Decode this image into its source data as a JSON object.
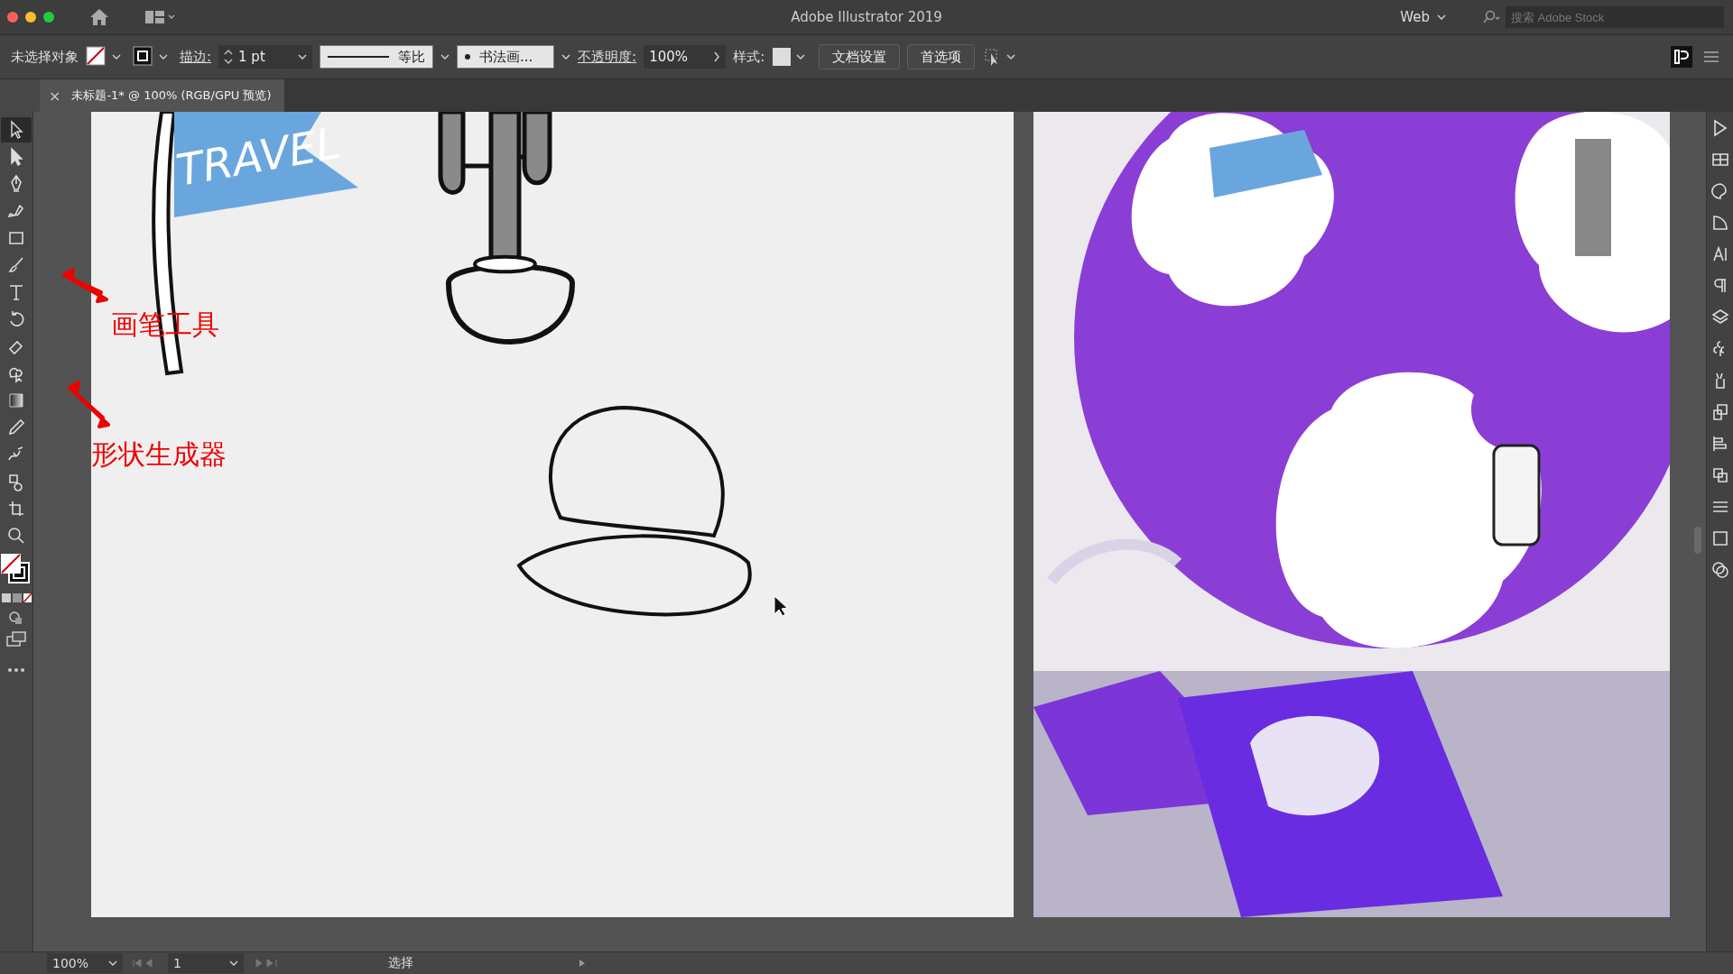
{
  "window": {
    "title": "Adobe Illustrator 2019",
    "workspace": "Web",
    "search": {
      "placeholder": "搜索 Adobe Stock"
    }
  },
  "control_bar": {
    "selection": "未选择对象",
    "stroke_label": "描边:",
    "stroke_weight": "1 pt",
    "stroke_profile": "等比",
    "brush": "书法画...",
    "opacity_label": "不透明度:",
    "opacity": "100%",
    "style_label": "样式:",
    "buttons": [
      "文档设置",
      "首选项"
    ]
  },
  "document_tab": {
    "close": "×",
    "title": "未标题-1* @ 100% (RGB/GPU 预览)"
  },
  "tools": [
    {
      "kind": "selection",
      "selected": true
    },
    {
      "kind": "direct",
      "selected": false
    },
    {
      "kind": "pen",
      "selected": false
    },
    {
      "kind": "curvature",
      "selected": false
    },
    {
      "kind": "rectangle",
      "selected": false
    },
    {
      "kind": "brush",
      "selected": false
    },
    {
      "kind": "type",
      "selected": false
    },
    {
      "kind": "rotate",
      "selected": false
    },
    {
      "kind": "eraser",
      "selected": false
    },
    {
      "kind": "shapebuilder",
      "selected": false
    },
    {
      "kind": "gradient",
      "selected": false
    },
    {
      "kind": "eyedropper",
      "selected": false
    },
    {
      "kind": "puppet",
      "selected": false
    },
    {
      "kind": "symbol",
      "selected": false
    },
    {
      "kind": "artboard",
      "selected": false
    },
    {
      "kind": "zoom",
      "selected": false
    }
  ],
  "artboard": {
    "flag_text": "TRAVEL"
  },
  "annotations": [
    {
      "text": "画笔工具"
    },
    {
      "text": "形状生成器"
    }
  ],
  "status_bar": {
    "zoom": "100%",
    "artboard": "1",
    "tool": "选择"
  }
}
